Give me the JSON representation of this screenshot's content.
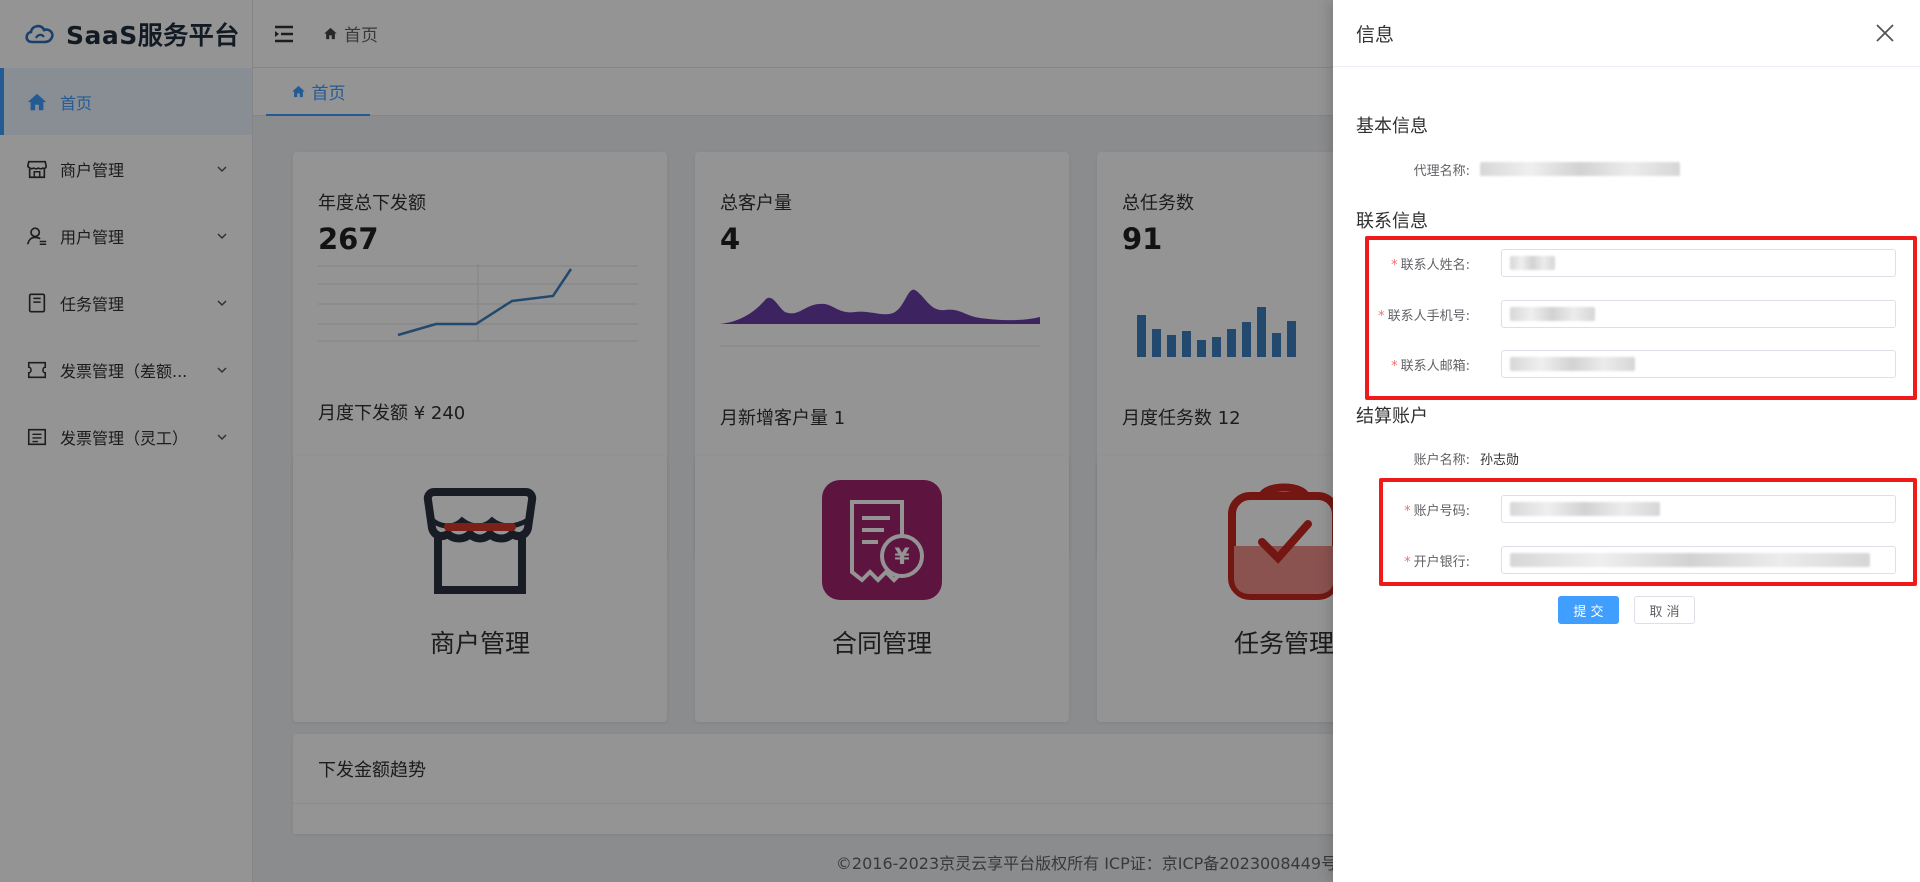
{
  "app": {
    "title": "SaaS服务平台"
  },
  "sidebar": {
    "items": [
      {
        "label": "首页",
        "icon": "home-icon"
      },
      {
        "label": "商户管理",
        "icon": "shop-icon"
      },
      {
        "label": "用户管理",
        "icon": "user-icon"
      },
      {
        "label": "任务管理",
        "icon": "task-icon"
      },
      {
        "label": "发票管理（差额...",
        "icon": "invoice-icon"
      },
      {
        "label": "发票管理（灵工）",
        "icon": "invoice-flex-icon"
      }
    ]
  },
  "header": {
    "breadcrumb": "首页"
  },
  "tags": [
    {
      "label": "首页"
    }
  ],
  "stats": [
    {
      "title": "年度总下发额",
      "value": "267",
      "footer": "月度下发额 ¥ 240"
    },
    {
      "title": "总客户量",
      "value": "4",
      "footer": "月新增客户量 1"
    },
    {
      "title": "总任务数",
      "value": "91",
      "footer": "月度任务数 12"
    }
  ],
  "shortcuts": [
    {
      "label": "商户管理"
    },
    {
      "label": "合同管理"
    },
    {
      "label": "任务管理"
    }
  ],
  "trend": {
    "title": "下发金额趋势"
  },
  "footer": {
    "text": "©2016-2023京灵云享平台版权所有 ICP证：京ICP备2023008449号"
  },
  "drawer": {
    "title": "信息",
    "sections": {
      "basic": "基本信息",
      "contact": "联系信息",
      "settlement": "结算账户"
    },
    "fields": {
      "agent_name_label": "代理名称:",
      "contact_name_label": "联系人姓名:",
      "contact_phone_label": "联系人手机号:",
      "contact_email_label": "联系人邮箱:",
      "account_name_label": "账户名称:",
      "account_name_value": "孙志勋",
      "account_number_label": "账户号码:",
      "bank_label": "开户银行:"
    },
    "buttons": {
      "submit": "提 交",
      "cancel": "取 消"
    }
  },
  "colors": {
    "accent": "#409eff",
    "highlight": "#ef1b1b",
    "line_chart": "#3f7fbf",
    "area_chart": "#6a3fa8",
    "bar_chart": "#3f7fbf"
  }
}
